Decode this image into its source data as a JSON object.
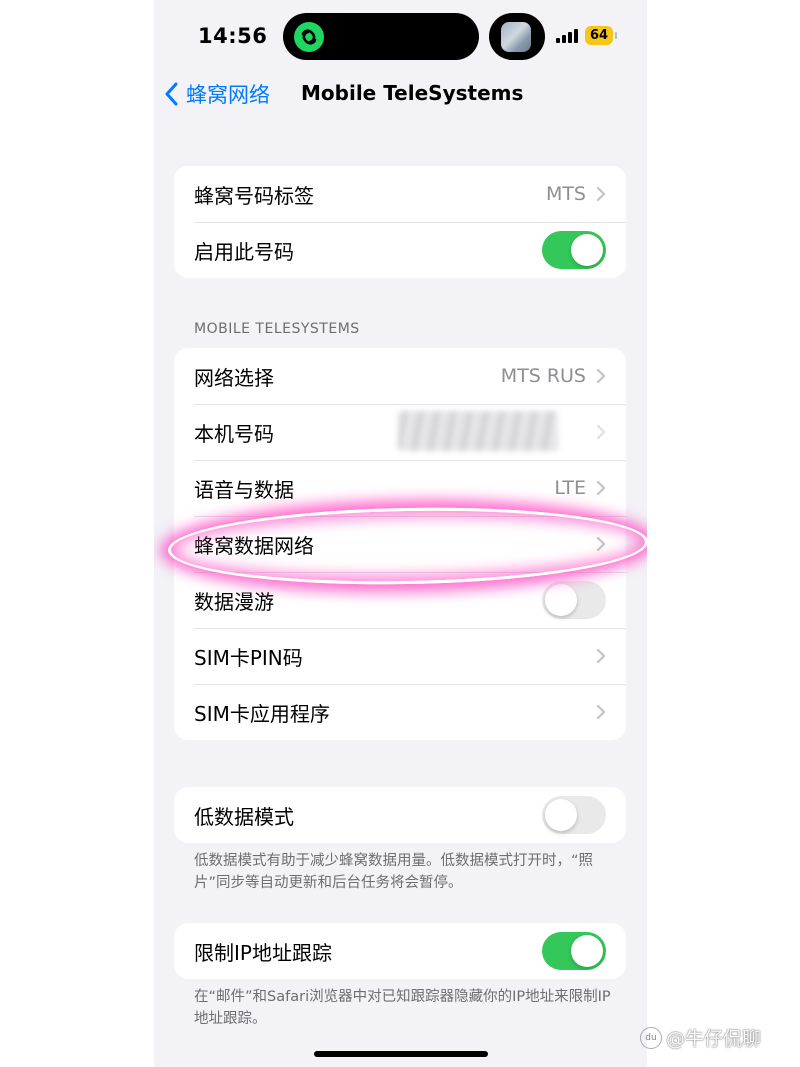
{
  "status": {
    "time": "14:56",
    "battery": "64",
    "island_app_icon": "link-icon",
    "signal_icon": "signal-icon"
  },
  "nav": {
    "back_label": "蜂窝网络",
    "title": "Mobile TeleSystems"
  },
  "group1": {
    "rows": [
      {
        "label": "蜂窝号码标签",
        "value": "MTS"
      },
      {
        "label": "启用此号码",
        "toggle": true
      }
    ]
  },
  "section_header": "MOBILE TELESYSTEMS",
  "group2": {
    "rows": [
      {
        "label": "网络选择",
        "value": "MTS RUS"
      },
      {
        "label": "本机号码",
        "value": ""
      },
      {
        "label": "语音与数据",
        "value": "LTE"
      },
      {
        "label": "蜂窝数据网络"
      },
      {
        "label": "数据漫游",
        "toggle": false
      },
      {
        "label": "SIM卡PIN码"
      },
      {
        "label": "SIM卡应用程序"
      }
    ]
  },
  "group3": {
    "rows": [
      {
        "label": "低数据模式",
        "toggle": false
      }
    ],
    "footnote": "低数据模式有助于减少蜂窝数据用量。低数据模式打开时，“照片”同步等自动更新和后台任务将会暂停。"
  },
  "group4": {
    "rows": [
      {
        "label": "限制IP地址跟踪",
        "toggle": true
      }
    ],
    "footnote": "在“邮件”和Safari浏览器中对已知跟踪器隐藏你的IP地址来限制IP地址跟踪。"
  },
  "watermark": {
    "badge": "du",
    "text": "@牛仔侃聊"
  },
  "colors": {
    "accent": "#007aff",
    "toggle_on": "#34c759",
    "highlight": "#ff3cbe"
  }
}
